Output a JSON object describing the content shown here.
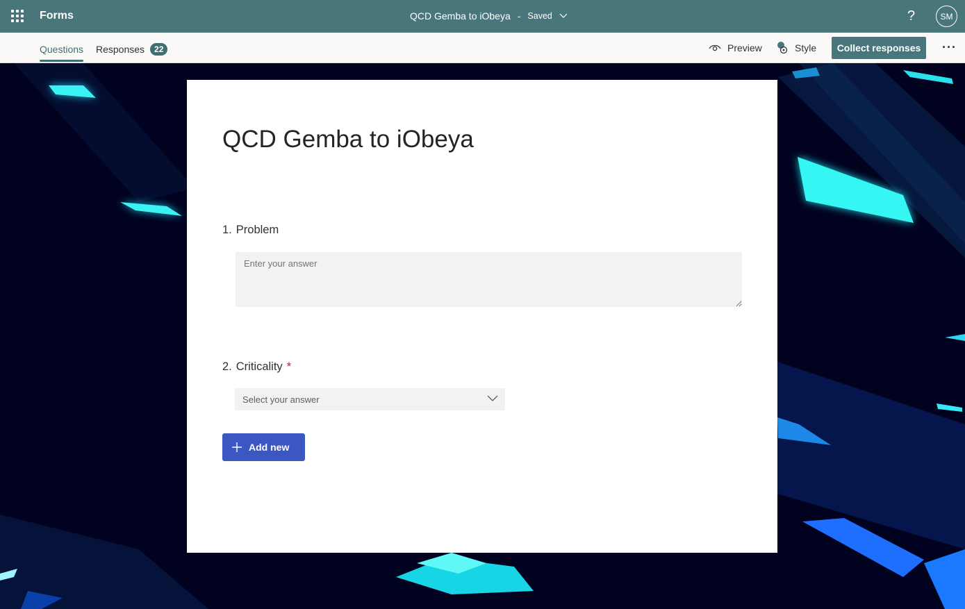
{
  "app": {
    "name": "Forms"
  },
  "header": {
    "form_title": "QCD Gemba to iObeya",
    "separator": "-",
    "status": "Saved",
    "help": "?",
    "avatar_initials": "SM"
  },
  "tabs": [
    {
      "label": "Questions",
      "active": true
    },
    {
      "label": "Responses",
      "badge": "22",
      "active": false
    }
  ],
  "toolbar": {
    "preview_label": "Preview",
    "style_label": "Style",
    "collect_label": "Collect responses",
    "more_label": "···"
  },
  "form": {
    "title": "QCD Gemba to iObeya",
    "questions": [
      {
        "number": "1.",
        "label": "Problem",
        "placeholder": "Enter your answer",
        "required": false
      },
      {
        "number": "2.",
        "label": "Criticality",
        "placeholder": "Select your answer",
        "required": true,
        "required_mark": "*"
      }
    ],
    "add_new_label": "Add new"
  },
  "colors": {
    "header_bg": "#49767b",
    "accent": "#3d6f73",
    "add_button": "#3b57c1",
    "theme_bg": "#01021f",
    "theme_shard": "#32f4f2"
  },
  "icons": [
    "waffle-icon",
    "chevron-down-icon",
    "eye-icon",
    "style-icon",
    "plus-icon",
    "more-icon"
  ]
}
